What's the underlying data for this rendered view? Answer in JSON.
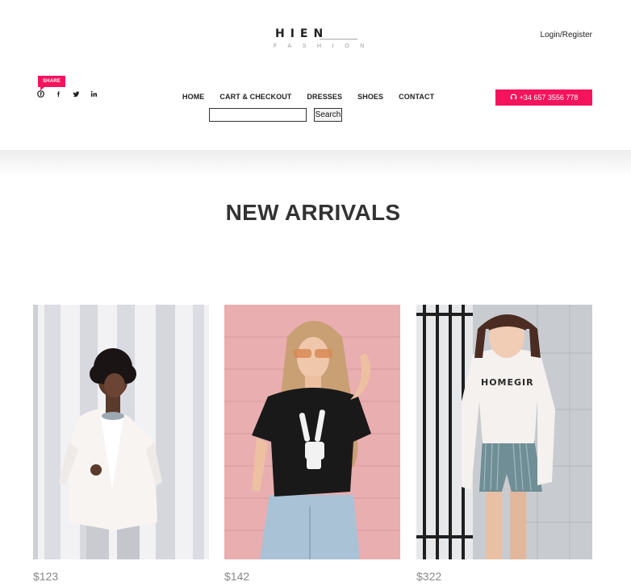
{
  "brand": {
    "name": "HIEN",
    "tagline": "FASHION"
  },
  "header": {
    "login_label": "Login/Register",
    "share_label": "SHARE",
    "social": [
      "pinterest-icon",
      "facebook-icon",
      "twitter-icon",
      "linkedin-icon"
    ],
    "phone": "+34 657 3556 778"
  },
  "nav": {
    "items": [
      "HOME",
      "CART & CHECKOUT",
      "DRESSES",
      "SHOES",
      "CONTACT"
    ]
  },
  "search": {
    "value": "",
    "button_label": "Search"
  },
  "section": {
    "title": "NEW ARRIVALS"
  },
  "products": [
    {
      "price": "$123"
    },
    {
      "price": "$142"
    },
    {
      "price": "$322"
    }
  ],
  "colors": {
    "accent": "#f5135e",
    "text": "#222222",
    "price": "#888888"
  }
}
